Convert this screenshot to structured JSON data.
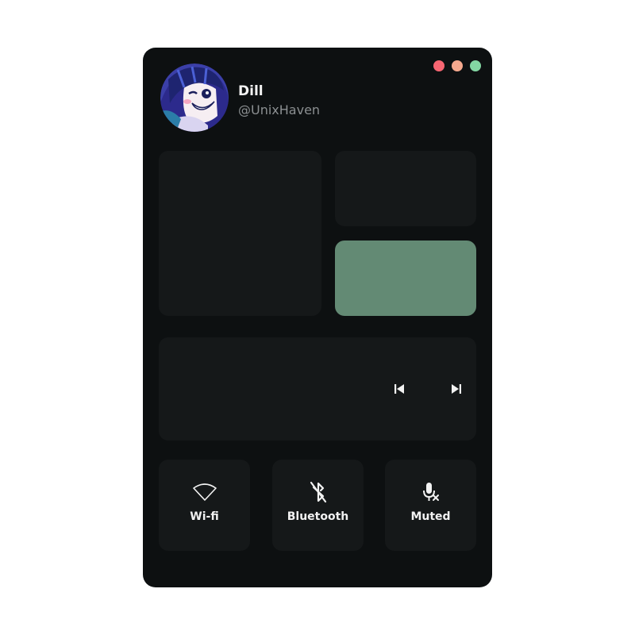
{
  "window": {
    "controls": [
      {
        "name": "close",
        "color": "#f76672"
      },
      {
        "name": "minimize",
        "color": "#f6a98e"
      },
      {
        "name": "maximize",
        "color": "#83d7a3"
      }
    ]
  },
  "profile": {
    "name": "Dill",
    "handle": "@UnixHaven",
    "avatar_icon": "anime-character-avatar"
  },
  "theme": {
    "panel_bg": "#0d1011",
    "tile_bg": "#151819",
    "accent": "#638a74",
    "text": "#f2f2f2",
    "muted_text": "#8b8f91"
  },
  "media": {
    "prev_icon": "skip-previous-icon",
    "next_icon": "skip-next-icon"
  },
  "toggles": [
    {
      "label": "Wi-fi",
      "icon": "wifi-icon"
    },
    {
      "label": "Bluetooth",
      "icon": "bluetooth-off-icon"
    },
    {
      "label": "Muted",
      "icon": "microphone-muted-icon"
    }
  ]
}
